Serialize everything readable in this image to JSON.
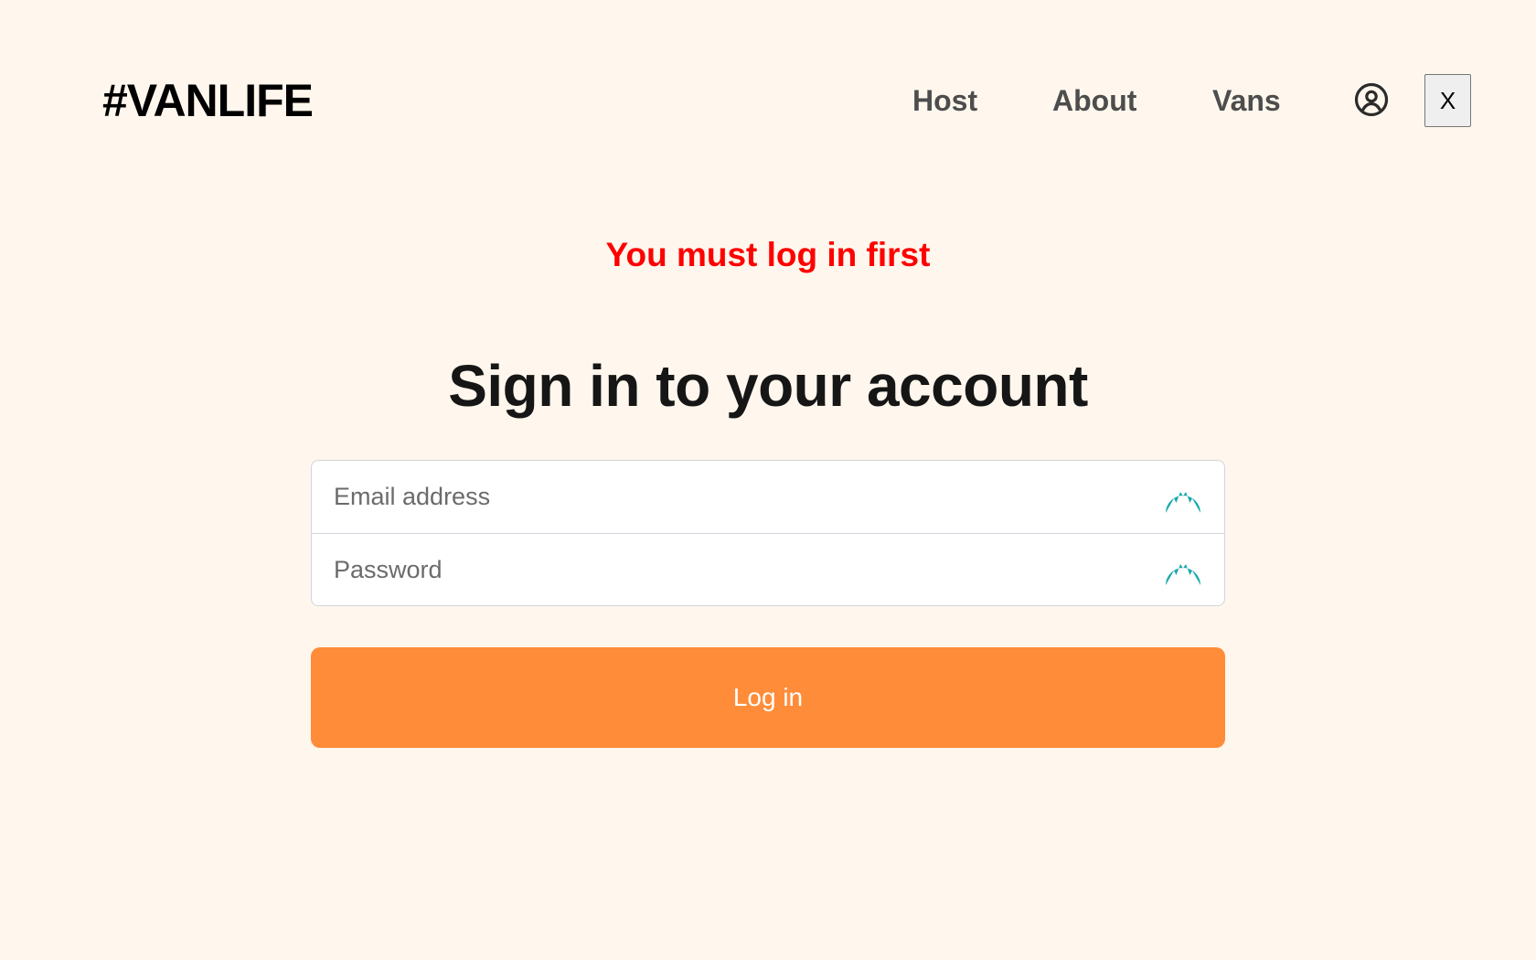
{
  "header": {
    "logo": "#VANLIFE",
    "nav": {
      "host": "Host",
      "about": "About",
      "vans": "Vans"
    },
    "user_icon": "user-circle-icon",
    "close_label": "X"
  },
  "main": {
    "alert": "You must log in first",
    "title": "Sign in to your account",
    "form": {
      "email": {
        "placeholder": "Email address",
        "value": ""
      },
      "password": {
        "placeholder": "Password",
        "value": ""
      },
      "field_icon": "nordpass-icon",
      "submit_label": "Log in"
    }
  },
  "colors": {
    "background": "#FFF7ED",
    "accent": "#FF8C38",
    "alert": "#FF0000",
    "field_icon": "#1AA8A8"
  }
}
